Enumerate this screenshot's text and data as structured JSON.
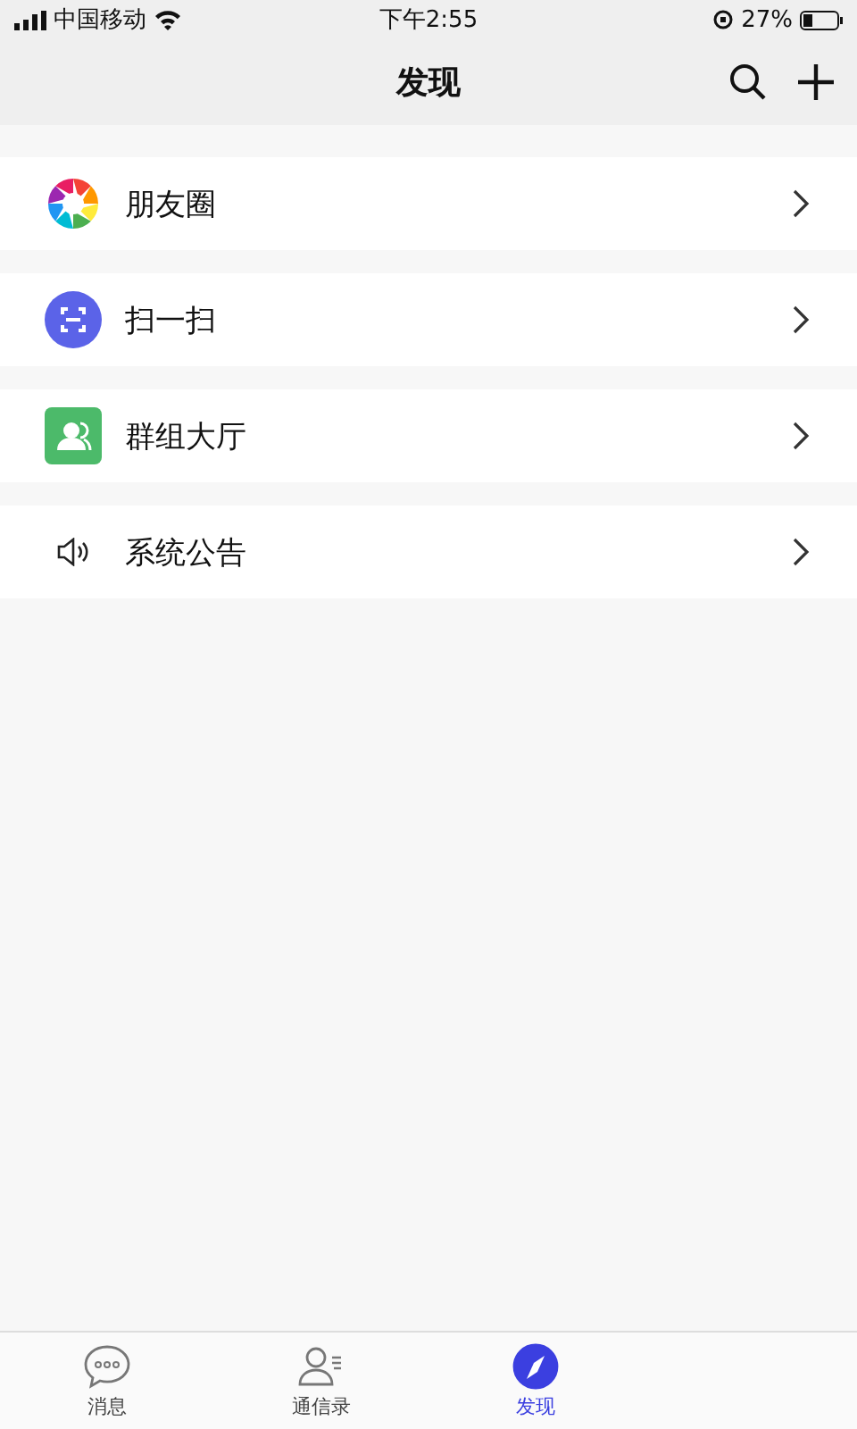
{
  "status_bar": {
    "carrier": "中国移动",
    "time": "下午2:55",
    "battery": "27%"
  },
  "nav": {
    "title": "发现"
  },
  "items": [
    {
      "kind": "moments",
      "label": "朋友圈"
    },
    {
      "kind": "scan",
      "label": "扫一扫"
    },
    {
      "kind": "group",
      "label": "群组大厅"
    },
    {
      "kind": "speaker",
      "label": "系统公告"
    }
  ],
  "tabs": [
    {
      "kind": "chat",
      "label": "消息",
      "selected": false
    },
    {
      "kind": "contacts",
      "label": "通信录",
      "selected": false
    },
    {
      "kind": "discover",
      "label": "发现",
      "selected": true
    }
  ]
}
